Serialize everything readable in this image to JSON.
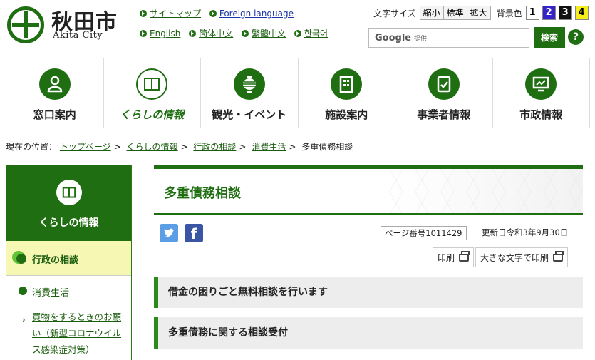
{
  "header": {
    "logo_jp": "秋田市",
    "logo_en": "Akita City",
    "links_row1": [
      {
        "label": "サイトマップ",
        "color": "#1a5d0e"
      },
      {
        "label": "Foreign language",
        "color": "#1a33a8"
      }
    ],
    "links_row2": [
      {
        "label": "English"
      },
      {
        "label": "简体中文"
      },
      {
        "label": "繁體中文"
      },
      {
        "label": "한국어"
      }
    ],
    "text_size_label": "文字サイズ",
    "text_size_buttons": [
      "縮小",
      "標準",
      "拡大"
    ],
    "bg_color_label": "背景色",
    "bg_buttons": [
      "1",
      "2",
      "3",
      "4"
    ],
    "search": {
      "brand": "Google",
      "provided": "提供",
      "button": "検索"
    },
    "help": "?"
  },
  "gnav": [
    {
      "label": "窓口案内",
      "icon": "person-icon"
    },
    {
      "label": "くらしの情報",
      "icon": "book-icon",
      "active": true
    },
    {
      "label": "観光・イベント",
      "icon": "lantern-icon"
    },
    {
      "label": "施設案内",
      "icon": "building-icon"
    },
    {
      "label": "事業者情報",
      "icon": "document-check-icon"
    },
    {
      "label": "市政情報",
      "icon": "monitor-chart-icon"
    }
  ],
  "breadcrumb": {
    "prefix": "現在の位置：",
    "items": [
      "トップページ",
      "くらしの情報",
      "行政の相談",
      "消費生活"
    ],
    "current": "多重債務相談",
    "sep": ">"
  },
  "sidebar": {
    "heading": "くらしの情報",
    "current": "行政の相談",
    "sub": "消費生活",
    "leaf": "買物をするときのお願い（新型コロナウイルス感染症対策）"
  },
  "main": {
    "title": "多重債務相談",
    "page_number": "ページ番号1011429",
    "updated": "更新日令和3年9月30日",
    "print": "印刷",
    "print_large": "大きな文字で印刷",
    "headings": [
      "借金の困りごと無料相談を行います",
      "多重債務に関する相談受付"
    ]
  },
  "colors": {
    "brand_green": "#1f6e12",
    "highlight": "#f7f7b4"
  }
}
